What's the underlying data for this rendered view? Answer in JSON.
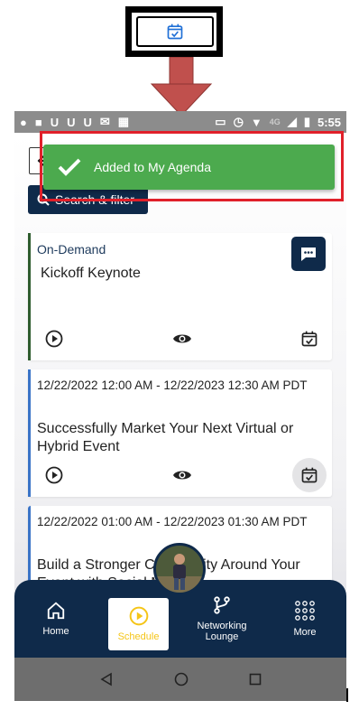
{
  "status_bar": {
    "time": "5:55",
    "network": "4G",
    "letters": [
      "U",
      "U",
      "U"
    ]
  },
  "search": {
    "label": "Search & filter"
  },
  "toast": {
    "message": "Added to My Agenda",
    "color": "#4caa4e"
  },
  "cards": [
    {
      "meta": "On-Demand",
      "title": "Kickoff Keynote",
      "accent": "#2e5c2e"
    },
    {
      "meta": "12/22/2022 12:00 AM - 12/22/2023 12:30 AM PDT",
      "title": "Successfully Market Your Next Virtual or Hybrid Event",
      "accent": "#3a74c7"
    },
    {
      "meta": "12/22/2022 01:00 AM - 12/22/2023 01:30 AM PDT",
      "title": "Build a Stronger Community Around Your Event with Social Media",
      "accent": "#3a74c7"
    }
  ],
  "nav": {
    "home": "Home",
    "schedule": "Schedule",
    "networking": "Networking Lounge",
    "more": "More"
  },
  "colors": {
    "navy": "#0f2a4a",
    "accent_yellow": "#f5c518",
    "highlight_red": "#e0202a",
    "arrow_red": "#c0504d"
  }
}
